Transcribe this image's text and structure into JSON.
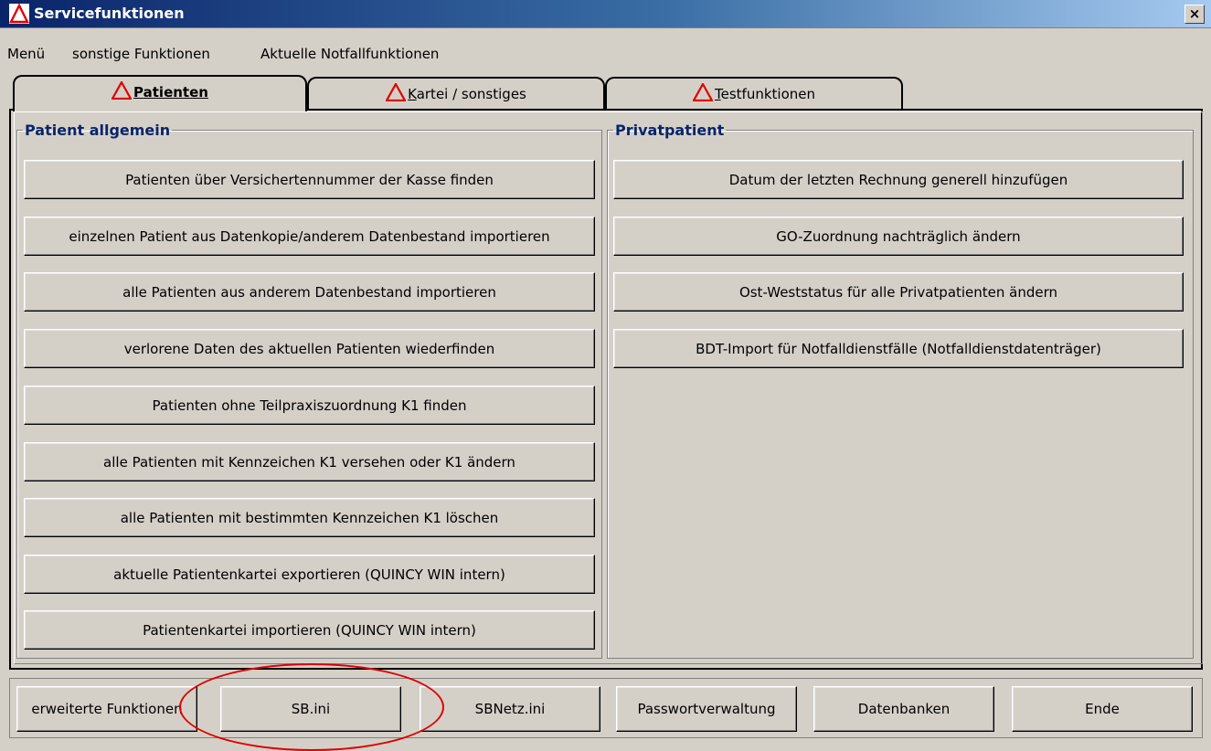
{
  "window": {
    "title": "Servicefunktionen",
    "close_label": "×"
  },
  "menu": [
    "Menü",
    "sonstige Funktionen",
    "Aktuelle Notfallfunktionen"
  ],
  "tabs": [
    {
      "first": "P",
      "rest": "atienten"
    },
    {
      "first": "K",
      "rest": "artei / sonstiges"
    },
    {
      "first": "T",
      "rest": "estfunktionen"
    }
  ],
  "patient_allgemein": {
    "legend": "Patient allgemein",
    "buttons": [
      "Patienten über Versichertennummer der Kasse finden",
      "einzelnen Patient aus Datenkopie/anderem Datenbestand importieren",
      "alle Patienten aus anderem Datenbestand importieren",
      "verlorene Daten des aktuellen Patienten wiederfinden",
      "Patienten ohne Teilpraxiszuordnung K1 finden",
      "alle Patienten mit Kennzeichen K1 versehen oder K1 ändern",
      "alle Patienten mit bestimmten Kennzeichen K1 löschen",
      "aktuelle Patientenkartei  exportieren (QUINCY WIN intern)",
      "Patientenkartei importieren (QUINCY WIN intern)"
    ]
  },
  "privatpatient": {
    "legend": "Privatpatient",
    "buttons": [
      "Datum der letzten Rechnung generell hinzufügen",
      "GO-Zuordnung nachträglich ändern",
      "Ost-Weststatus für alle Privatpatienten ändern",
      "BDT-Import für Notfalldienstfälle (Notfalldienstdatenträger)"
    ]
  },
  "bottom_buttons": [
    "erweiterte Funktionen",
    "SB.ini",
    "SBNetz.ini",
    "Passwortverwaltung",
    "Datenbanken",
    "Ende"
  ],
  "accent": {
    "warning_red": "#e00000",
    "legend_blue": "#0a246a",
    "title_blue": "#0a246a"
  }
}
